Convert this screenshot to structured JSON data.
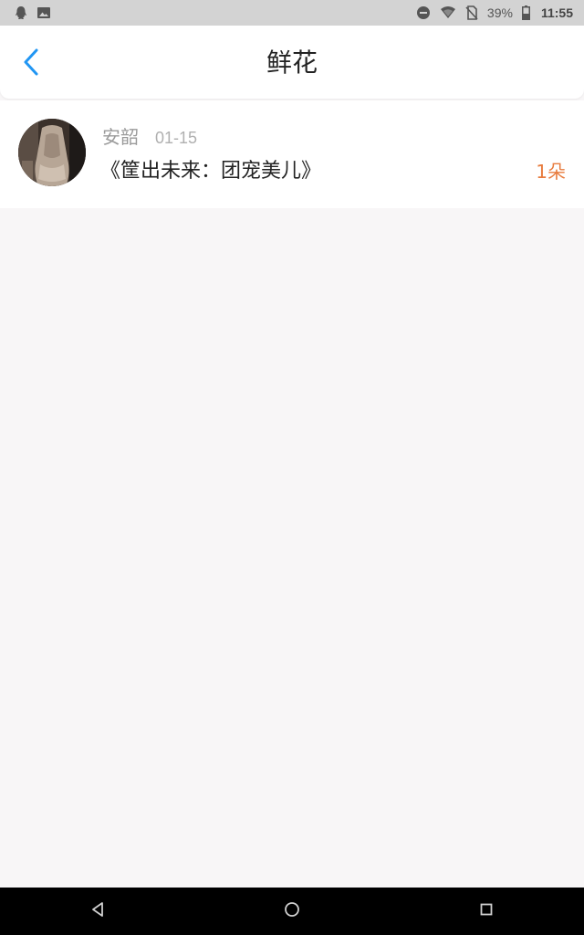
{
  "status_bar": {
    "left_icons": [
      "qq-icon",
      "image-icon"
    ],
    "right_icons": [
      "do-not-disturb-icon",
      "wifi-icon",
      "no-sim-icon",
      "battery-icon"
    ],
    "battery": "39%",
    "time": "11:55"
  },
  "header": {
    "title": "鲜花",
    "back_icon": "chevron-left-icon",
    "accent": "#2196f3"
  },
  "items": [
    {
      "user": "安韶",
      "date": "01-15",
      "book": "《筐出未来：团宠美儿》",
      "count": "1朵",
      "count_color": "#e87c3e"
    }
  ],
  "nav": {
    "buttons": [
      "back-triangle-icon",
      "home-circle-icon",
      "recents-square-icon"
    ]
  }
}
